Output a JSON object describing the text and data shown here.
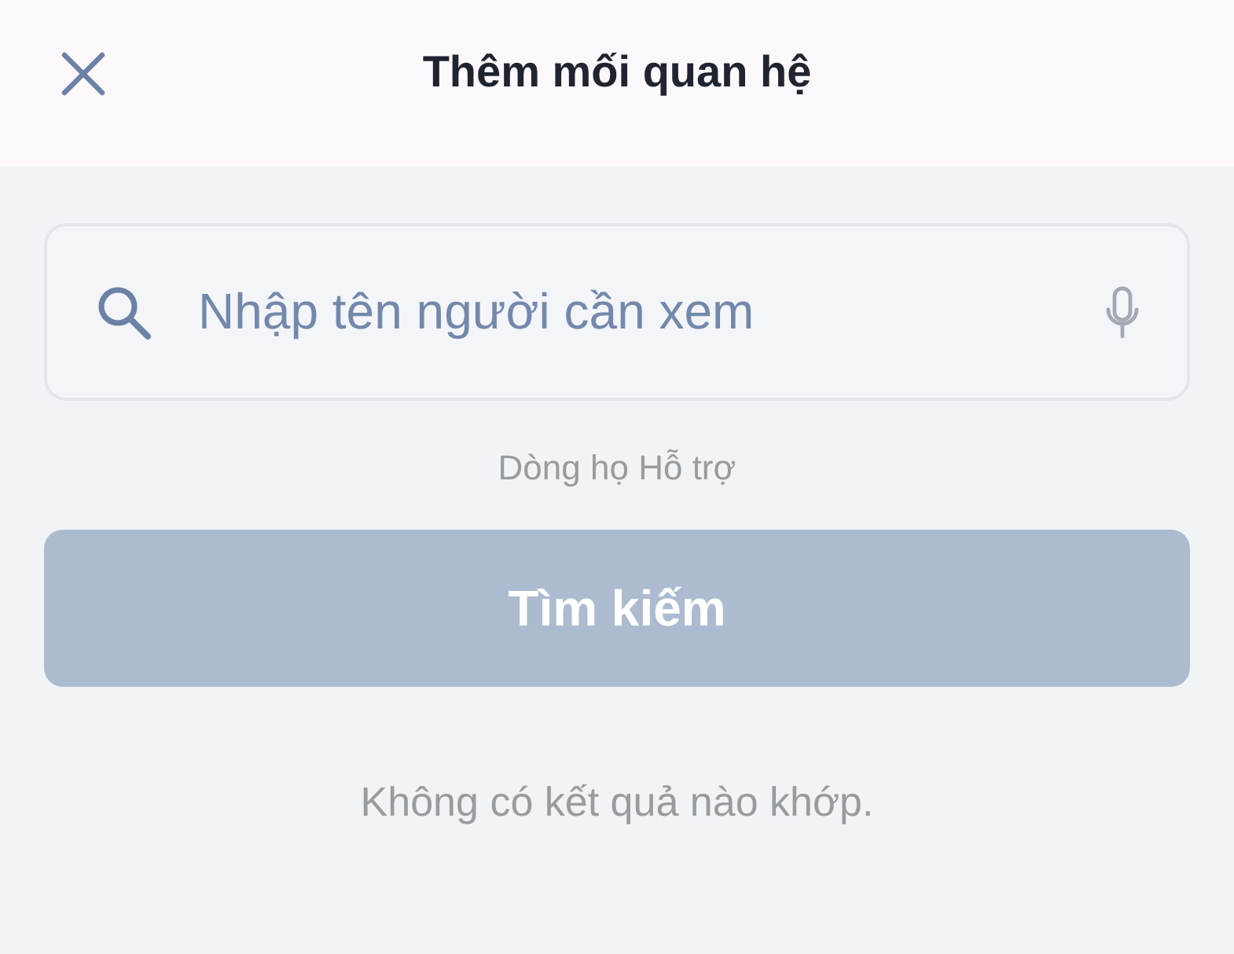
{
  "header": {
    "title": "Thêm mối quan hệ"
  },
  "search": {
    "placeholder": "Nhập tên người cần xem"
  },
  "caption": "Dòng họ Hỗ trợ",
  "search_button": {
    "label": "Tìm kiếm",
    "disabled": true
  },
  "empty_message": "Không có kết quả nào khớp."
}
